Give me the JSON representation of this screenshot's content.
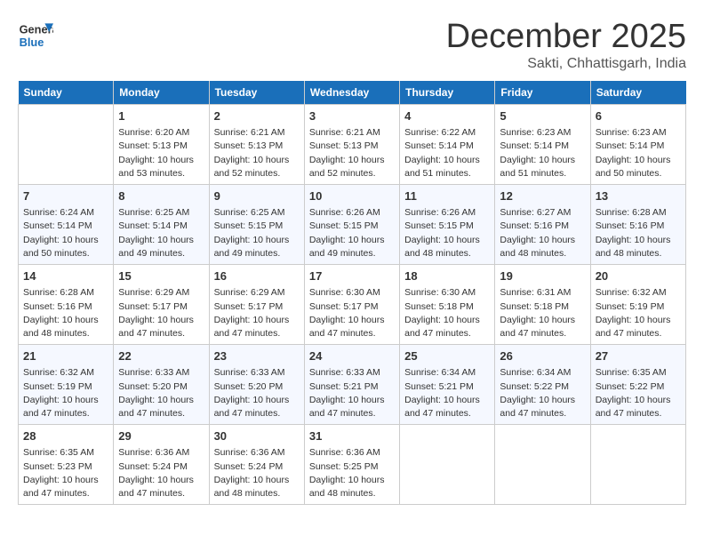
{
  "header": {
    "logo_general": "General",
    "logo_blue": "Blue",
    "month_title": "December 2025",
    "location": "Sakti, Chhattisgarh, India"
  },
  "days_of_week": [
    "Sunday",
    "Monday",
    "Tuesday",
    "Wednesday",
    "Thursday",
    "Friday",
    "Saturday"
  ],
  "weeks": [
    [
      {
        "day": "",
        "info": ""
      },
      {
        "day": "1",
        "info": "Sunrise: 6:20 AM\nSunset: 5:13 PM\nDaylight: 10 hours\nand 53 minutes."
      },
      {
        "day": "2",
        "info": "Sunrise: 6:21 AM\nSunset: 5:13 PM\nDaylight: 10 hours\nand 52 minutes."
      },
      {
        "day": "3",
        "info": "Sunrise: 6:21 AM\nSunset: 5:13 PM\nDaylight: 10 hours\nand 52 minutes."
      },
      {
        "day": "4",
        "info": "Sunrise: 6:22 AM\nSunset: 5:14 PM\nDaylight: 10 hours\nand 51 minutes."
      },
      {
        "day": "5",
        "info": "Sunrise: 6:23 AM\nSunset: 5:14 PM\nDaylight: 10 hours\nand 51 minutes."
      },
      {
        "day": "6",
        "info": "Sunrise: 6:23 AM\nSunset: 5:14 PM\nDaylight: 10 hours\nand 50 minutes."
      }
    ],
    [
      {
        "day": "7",
        "info": "Sunrise: 6:24 AM\nSunset: 5:14 PM\nDaylight: 10 hours\nand 50 minutes."
      },
      {
        "day": "8",
        "info": "Sunrise: 6:25 AM\nSunset: 5:14 PM\nDaylight: 10 hours\nand 49 minutes."
      },
      {
        "day": "9",
        "info": "Sunrise: 6:25 AM\nSunset: 5:15 PM\nDaylight: 10 hours\nand 49 minutes."
      },
      {
        "day": "10",
        "info": "Sunrise: 6:26 AM\nSunset: 5:15 PM\nDaylight: 10 hours\nand 49 minutes."
      },
      {
        "day": "11",
        "info": "Sunrise: 6:26 AM\nSunset: 5:15 PM\nDaylight: 10 hours\nand 48 minutes."
      },
      {
        "day": "12",
        "info": "Sunrise: 6:27 AM\nSunset: 5:16 PM\nDaylight: 10 hours\nand 48 minutes."
      },
      {
        "day": "13",
        "info": "Sunrise: 6:28 AM\nSunset: 5:16 PM\nDaylight: 10 hours\nand 48 minutes."
      }
    ],
    [
      {
        "day": "14",
        "info": "Sunrise: 6:28 AM\nSunset: 5:16 PM\nDaylight: 10 hours\nand 48 minutes."
      },
      {
        "day": "15",
        "info": "Sunrise: 6:29 AM\nSunset: 5:17 PM\nDaylight: 10 hours\nand 47 minutes."
      },
      {
        "day": "16",
        "info": "Sunrise: 6:29 AM\nSunset: 5:17 PM\nDaylight: 10 hours\nand 47 minutes."
      },
      {
        "day": "17",
        "info": "Sunrise: 6:30 AM\nSunset: 5:17 PM\nDaylight: 10 hours\nand 47 minutes."
      },
      {
        "day": "18",
        "info": "Sunrise: 6:30 AM\nSunset: 5:18 PM\nDaylight: 10 hours\nand 47 minutes."
      },
      {
        "day": "19",
        "info": "Sunrise: 6:31 AM\nSunset: 5:18 PM\nDaylight: 10 hours\nand 47 minutes."
      },
      {
        "day": "20",
        "info": "Sunrise: 6:32 AM\nSunset: 5:19 PM\nDaylight: 10 hours\nand 47 minutes."
      }
    ],
    [
      {
        "day": "21",
        "info": "Sunrise: 6:32 AM\nSunset: 5:19 PM\nDaylight: 10 hours\nand 47 minutes."
      },
      {
        "day": "22",
        "info": "Sunrise: 6:33 AM\nSunset: 5:20 PM\nDaylight: 10 hours\nand 47 minutes."
      },
      {
        "day": "23",
        "info": "Sunrise: 6:33 AM\nSunset: 5:20 PM\nDaylight: 10 hours\nand 47 minutes."
      },
      {
        "day": "24",
        "info": "Sunrise: 6:33 AM\nSunset: 5:21 PM\nDaylight: 10 hours\nand 47 minutes."
      },
      {
        "day": "25",
        "info": "Sunrise: 6:34 AM\nSunset: 5:21 PM\nDaylight: 10 hours\nand 47 minutes."
      },
      {
        "day": "26",
        "info": "Sunrise: 6:34 AM\nSunset: 5:22 PM\nDaylight: 10 hours\nand 47 minutes."
      },
      {
        "day": "27",
        "info": "Sunrise: 6:35 AM\nSunset: 5:22 PM\nDaylight: 10 hours\nand 47 minutes."
      }
    ],
    [
      {
        "day": "28",
        "info": "Sunrise: 6:35 AM\nSunset: 5:23 PM\nDaylight: 10 hours\nand 47 minutes."
      },
      {
        "day": "29",
        "info": "Sunrise: 6:36 AM\nSunset: 5:24 PM\nDaylight: 10 hours\nand 47 minutes."
      },
      {
        "day": "30",
        "info": "Sunrise: 6:36 AM\nSunset: 5:24 PM\nDaylight: 10 hours\nand 48 minutes."
      },
      {
        "day": "31",
        "info": "Sunrise: 6:36 AM\nSunset: 5:25 PM\nDaylight: 10 hours\nand 48 minutes."
      },
      {
        "day": "",
        "info": ""
      },
      {
        "day": "",
        "info": ""
      },
      {
        "day": "",
        "info": ""
      }
    ]
  ]
}
